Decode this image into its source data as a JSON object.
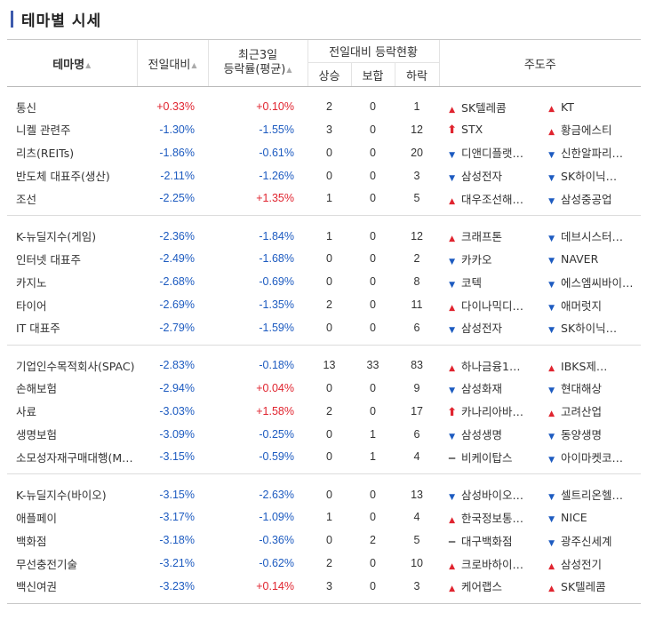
{
  "title": "테마별 시세",
  "header": {
    "theme_name": "테마명",
    "change": "전일대비",
    "recent3_line1": "최근3일",
    "recent3_line2": "등락률(평균)",
    "updown_status": "전일대비 등락현황",
    "rise": "상승",
    "flat": "보합",
    "fall": "하락",
    "leaders": "주도주",
    "sort_arrow": "▲"
  },
  "colors": {
    "up": "#e0242f",
    "down": "#1d5bc0",
    "title_bar": "#3d5aad"
  },
  "groups": [
    [
      {
        "name": "통신",
        "change": "+0.33%",
        "change_dir": "up",
        "recent3": "+0.10%",
        "recent3_dir": "up",
        "rise": "2",
        "flat": "0",
        "fall": "1",
        "s1": "SK텔레콤",
        "s1_ind": "up",
        "s2": "KT",
        "s2_ind": "up"
      },
      {
        "name": "니켈 관련주",
        "change": "-1.30%",
        "change_dir": "down",
        "recent3": "-1.55%",
        "recent3_dir": "down",
        "rise": "3",
        "flat": "0",
        "fall": "12",
        "s1": "STX",
        "s1_ind": "rise",
        "s2": "황금에스티",
        "s2_ind": "up"
      },
      {
        "name": "리츠(REITs)",
        "change": "-1.86%",
        "change_dir": "down",
        "recent3": "-0.61%",
        "recent3_dir": "down",
        "rise": "0",
        "flat": "0",
        "fall": "20",
        "s1": "디앤디플랫…",
        "s1_ind": "down",
        "s2": "신한알파리…",
        "s2_ind": "down"
      },
      {
        "name": "반도체 대표주(생산)",
        "change": "-2.11%",
        "change_dir": "down",
        "recent3": "-1.26%",
        "recent3_dir": "down",
        "rise": "0",
        "flat": "0",
        "fall": "3",
        "s1": "삼성전자",
        "s1_ind": "down",
        "s2": "SK하이닉…",
        "s2_ind": "down"
      },
      {
        "name": "조선",
        "change": "-2.25%",
        "change_dir": "down",
        "recent3": "+1.35%",
        "recent3_dir": "up",
        "rise": "1",
        "flat": "0",
        "fall": "5",
        "s1": "대우조선해…",
        "s1_ind": "up",
        "s2": "삼성중공업",
        "s2_ind": "down"
      }
    ],
    [
      {
        "name": "K-뉴딜지수(게임)",
        "change": "-2.36%",
        "change_dir": "down",
        "recent3": "-1.84%",
        "recent3_dir": "down",
        "rise": "1",
        "flat": "0",
        "fall": "12",
        "s1": "크래프톤",
        "s1_ind": "up",
        "s2": "데브시스터…",
        "s2_ind": "down"
      },
      {
        "name": "인터넷 대표주",
        "change": "-2.49%",
        "change_dir": "down",
        "recent3": "-1.68%",
        "recent3_dir": "down",
        "rise": "0",
        "flat": "0",
        "fall": "2",
        "s1": "카카오",
        "s1_ind": "down",
        "s2": "NAVER",
        "s2_ind": "down"
      },
      {
        "name": "카지노",
        "change": "-2.68%",
        "change_dir": "down",
        "recent3": "-0.69%",
        "recent3_dir": "down",
        "rise": "0",
        "flat": "0",
        "fall": "8",
        "s1": "코텍",
        "s1_ind": "down",
        "s2": "에스엠씨바이…",
        "s2_ind": "down"
      },
      {
        "name": "타이어",
        "change": "-2.69%",
        "change_dir": "down",
        "recent3": "-1.35%",
        "recent3_dir": "down",
        "rise": "2",
        "flat": "0",
        "fall": "11",
        "s1": "다이나믹디…",
        "s1_ind": "up",
        "s2": "애머럿지",
        "s2_ind": "down"
      },
      {
        "name": "IT 대표주",
        "change": "-2.79%",
        "change_dir": "down",
        "recent3": "-1.59%",
        "recent3_dir": "down",
        "rise": "0",
        "flat": "0",
        "fall": "6",
        "s1": "삼성전자",
        "s1_ind": "down",
        "s2": "SK하이닉…",
        "s2_ind": "down"
      }
    ],
    [
      {
        "name": "기업인수목적회사(SPAC)",
        "change": "-2.83%",
        "change_dir": "down",
        "recent3": "-0.18%",
        "recent3_dir": "down",
        "rise": "13",
        "flat": "33",
        "fall": "83",
        "s1": "하나금융1…",
        "s1_ind": "up",
        "s2": "IBKS제…",
        "s2_ind": "up"
      },
      {
        "name": "손해보험",
        "change": "-2.94%",
        "change_dir": "down",
        "recent3": "+0.04%",
        "recent3_dir": "up",
        "rise": "0",
        "flat": "0",
        "fall": "9",
        "s1": "삼성화재",
        "s1_ind": "down",
        "s2": "현대해상",
        "s2_ind": "down"
      },
      {
        "name": "사료",
        "change": "-3.03%",
        "change_dir": "down",
        "recent3": "+1.58%",
        "recent3_dir": "up",
        "rise": "2",
        "flat": "0",
        "fall": "17",
        "s1": "카나리아바…",
        "s1_ind": "rise",
        "s2": "고려산업",
        "s2_ind": "up"
      },
      {
        "name": "생명보험",
        "change": "-3.09%",
        "change_dir": "down",
        "recent3": "-0.25%",
        "recent3_dir": "down",
        "rise": "0",
        "flat": "1",
        "fall": "6",
        "s1": "삼성생명",
        "s1_ind": "down",
        "s2": "동양생명",
        "s2_ind": "down"
      },
      {
        "name": "소모성자재구매대행(M…",
        "change": "-3.15%",
        "change_dir": "down",
        "recent3": "-0.59%",
        "recent3_dir": "down",
        "rise": "0",
        "flat": "1",
        "fall": "4",
        "s1": "비케이탑스",
        "s1_ind": "flat",
        "s2": "아이마켓코…",
        "s2_ind": "down"
      }
    ],
    [
      {
        "name": "K-뉴딜지수(바이오)",
        "change": "-3.15%",
        "change_dir": "down",
        "recent3": "-2.63%",
        "recent3_dir": "down",
        "rise": "0",
        "flat": "0",
        "fall": "13",
        "s1": "삼성바이오…",
        "s1_ind": "down",
        "s2": "셀트리온헬…",
        "s2_ind": "down"
      },
      {
        "name": "애플페이",
        "change": "-3.17%",
        "change_dir": "down",
        "recent3": "-1.09%",
        "recent3_dir": "down",
        "rise": "1",
        "flat": "0",
        "fall": "4",
        "s1": "한국정보통…",
        "s1_ind": "up",
        "s2": "NICE",
        "s2_ind": "down"
      },
      {
        "name": "백화점",
        "change": "-3.18%",
        "change_dir": "down",
        "recent3": "-0.36%",
        "recent3_dir": "down",
        "rise": "0",
        "flat": "2",
        "fall": "5",
        "s1": "대구백화점",
        "s1_ind": "flat",
        "s2": "광주신세계",
        "s2_ind": "down"
      },
      {
        "name": "무선충전기술",
        "change": "-3.21%",
        "change_dir": "down",
        "recent3": "-0.62%",
        "recent3_dir": "down",
        "rise": "2",
        "flat": "0",
        "fall": "10",
        "s1": "크로바하이…",
        "s1_ind": "up",
        "s2": "삼성전기",
        "s2_ind": "up"
      },
      {
        "name": "백신여권",
        "change": "-3.23%",
        "change_dir": "down",
        "recent3": "+0.14%",
        "recent3_dir": "up",
        "rise": "3",
        "flat": "0",
        "fall": "3",
        "s1": "케어랩스",
        "s1_ind": "up",
        "s2": "SK텔레콤",
        "s2_ind": "up"
      }
    ]
  ]
}
